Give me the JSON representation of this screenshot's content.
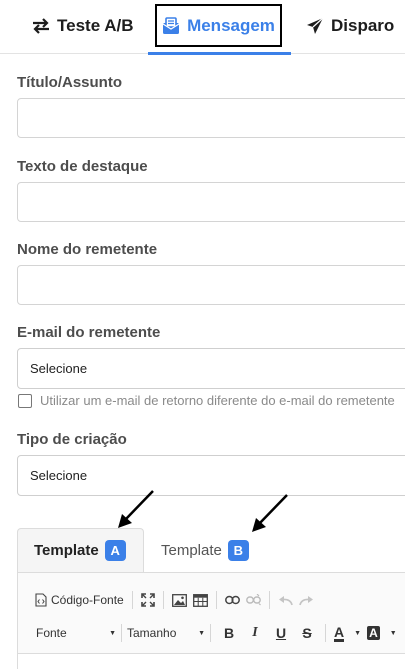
{
  "tabs": {
    "ab_test": "Teste A/B",
    "message": "Mensagem",
    "dispatch": "Disparo"
  },
  "form": {
    "subject_label": "Título/Assunto",
    "highlight_label": "Texto de destaque",
    "sender_name_label": "Nome do remetente",
    "sender_email_label": "E-mail do remetente",
    "sender_email_value": "Selecione",
    "return_email_checkbox": "Utilizar um e-mail de retorno diferente do e-mail do remetente",
    "creation_type_label": "Tipo de criação",
    "creation_type_value": "Selecione"
  },
  "templates": {
    "tab_a_label": "Template",
    "tab_a_badge": "A",
    "tab_b_label": "Template",
    "tab_b_badge": "B"
  },
  "editor": {
    "source_code": "Código-Fonte",
    "font_select": "Fonte",
    "size_select": "Tamanho",
    "bold": "B",
    "italic": "I",
    "underline": "U",
    "strike": "S",
    "text_color": "A",
    "bg_color": "A"
  },
  "colors": {
    "accent": "#3b80e8",
    "border": "#d4d4d4"
  }
}
